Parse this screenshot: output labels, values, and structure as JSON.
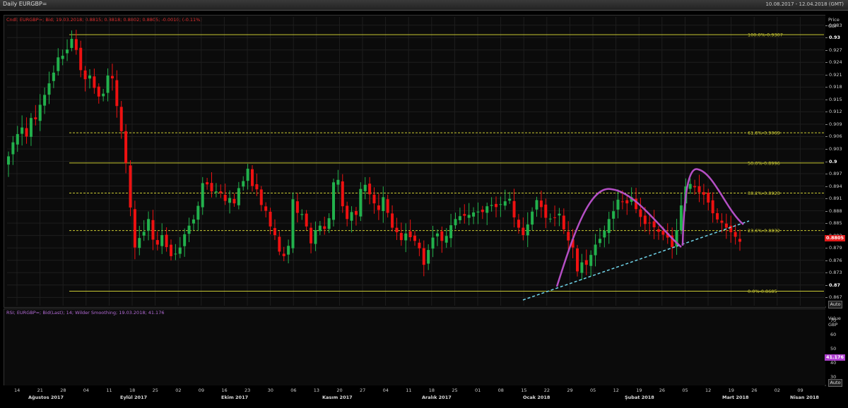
{
  "window": {
    "title": "Daily EURGBP=",
    "date_range": "10.08.2017 - 12.04.2018 (GMT)"
  },
  "price_panel": {
    "info_text": "Cndl; EURGBP=; Bid; 19.03.2018; 0.8815; 0.8818; 0.8802; 0.8805; -0.0010; (-0.11%)",
    "axis_title_1": "Price",
    "axis_title_2": "GBP",
    "auto_label": "Auto",
    "last_value_label": "0.8805",
    "colors": {
      "up": "#22b14c",
      "down": "#ee1111",
      "fib": "#c8c832",
      "pattern": "#b44fc4",
      "trend": "#6fd3e8",
      "info": "#e03030"
    }
  },
  "rsi_panel": {
    "info_text": "RSI; EURGBP=; Bid(Last); 14; Wilder Smoothing; 19.03.2018; 41.176",
    "axis_title_1": "Value",
    "axis_title_2": "GBP",
    "auto_label": "Auto",
    "last_value_label": "41.176",
    "colors": {
      "line": "#a243c9",
      "band": "#a243c9"
    }
  },
  "chart_data": [
    {
      "type": "candlestick",
      "title": "Daily EURGBP=",
      "ylabel": "Price GBP",
      "ylim": [
        0.865,
        0.935
      ],
      "y_ticks": [
        0.933,
        0.93,
        0.927,
        0.924,
        0.921,
        0.918,
        0.915,
        0.912,
        0.909,
        0.906,
        0.903,
        0.9,
        0.897,
        0.894,
        0.891,
        0.888,
        0.885,
        0.882,
        0.879,
        0.876,
        0.873,
        0.87,
        0.867
      ],
      "y_tick_labels": [
        "0.933",
        "0.93",
        "0.927",
        "0.924",
        "0.921",
        "0.918",
        "0.915",
        "0.912",
        "0.909",
        "0.906",
        "0.903",
        "0.9",
        "0.897",
        "0.894",
        "0.891",
        "0.888",
        "0.885",
        "0.882",
        "0.879",
        "0.876",
        "0.873",
        "0.87",
        "0.867"
      ],
      "x_day_ticks": [
        "14",
        "21",
        "28",
        "04",
        "11",
        "18",
        "25",
        "02",
        "09",
        "16",
        "23",
        "30",
        "06",
        "13",
        "20",
        "27",
        "04",
        "11",
        "18",
        "25",
        "01",
        "08",
        "15",
        "22",
        "29",
        "05",
        "12",
        "19",
        "26",
        "05",
        "12",
        "19",
        "26",
        "02",
        "09"
      ],
      "x_month_labels": [
        "Ağustos 2017",
        "Eylül 2017",
        "Ekim 2017",
        "Kasım 2017",
        "Aralık 2017",
        "Ocak 2018",
        "Şubat 2018",
        "Mart 2018",
        "Nisan 2018"
      ],
      "fibonacci_levels": [
        {
          "label": "100.0%-0.9307",
          "value": 0.9307,
          "style": "solid"
        },
        {
          "label": "61.8%-0.9069",
          "value": 0.9069,
          "style": "dashed"
        },
        {
          "label": "50.0%-0.8996",
          "value": 0.8996,
          "style": "solid"
        },
        {
          "label": "38.2%-0.8923",
          "value": 0.8923,
          "style": "dashed"
        },
        {
          "label": "23.6%-0.8832",
          "value": 0.8832,
          "style": "dashed"
        },
        {
          "label": "0.0%-0.8685",
          "value": 0.8685,
          "style": "solid"
        }
      ],
      "closes": [
        0.9012,
        0.9046,
        0.9066,
        0.9082,
        0.906,
        0.9105,
        0.9102,
        0.9137,
        0.9161,
        0.9189,
        0.9215,
        0.9252,
        0.9256,
        0.9271,
        0.9297,
        0.927,
        0.9221,
        0.9199,
        0.9208,
        0.9178,
        0.9157,
        0.9164,
        0.9208,
        0.9201,
        0.9134,
        0.9073,
        0.8996,
        0.8888,
        0.8791,
        0.8814,
        0.8829,
        0.886,
        0.881,
        0.8798,
        0.8821,
        0.8792,
        0.877,
        0.8776,
        0.8791,
        0.8823,
        0.8844,
        0.8859,
        0.8892,
        0.8947,
        0.8944,
        0.8927,
        0.8927,
        0.8923,
        0.8904,
        0.8911,
        0.8898,
        0.8935,
        0.8952,
        0.8982,
        0.894,
        0.8932,
        0.8894,
        0.888,
        0.8842,
        0.8821,
        0.8781,
        0.877,
        0.8795,
        0.8908,
        0.8875,
        0.8872,
        0.8842,
        0.8801,
        0.8833,
        0.8844,
        0.8836,
        0.8862,
        0.8949,
        0.8955,
        0.8891,
        0.886,
        0.8877,
        0.887,
        0.8933,
        0.8943,
        0.892,
        0.8898,
        0.8882,
        0.8913,
        0.8875,
        0.8839,
        0.8828,
        0.8809,
        0.8825,
        0.8816,
        0.8807,
        0.8789,
        0.8749,
        0.8785,
        0.8815,
        0.8825,
        0.8807,
        0.8819,
        0.8845,
        0.886,
        0.8867,
        0.8868,
        0.887,
        0.8876,
        0.8878,
        0.8877,
        0.8891,
        0.8894,
        0.8889,
        0.8896,
        0.8903,
        0.8909,
        0.8864,
        0.8839,
        0.8821,
        0.8847,
        0.8878,
        0.8906,
        0.8889,
        0.8863,
        0.8861,
        0.8863,
        0.8873,
        0.8835,
        0.8808,
        0.8791,
        0.8733,
        0.8755,
        0.8749,
        0.8773,
        0.8798,
        0.8812,
        0.8832,
        0.886,
        0.8879,
        0.8907,
        0.8902,
        0.8898,
        0.8913,
        0.8884,
        0.8865,
        0.8848,
        0.885,
        0.884,
        0.8829,
        0.8822,
        0.8815,
        0.8792,
        0.8833,
        0.8893,
        0.8939,
        0.8945,
        0.8937,
        0.8925,
        0.8919,
        0.89,
        0.8874,
        0.8859,
        0.8851,
        0.8839,
        0.8828,
        0.8817,
        0.8805
      ]
    },
    {
      "type": "line",
      "title": "RSI; EURGBP=; Bid(Last); 14; Wilder Smoothing",
      "ylabel": "Value GBP",
      "ylim": [
        25,
        77
      ],
      "y_ticks": [
        70,
        60,
        50,
        40,
        30
      ],
      "bands": [
        70,
        30
      ],
      "last_value": 41.176
    }
  ]
}
